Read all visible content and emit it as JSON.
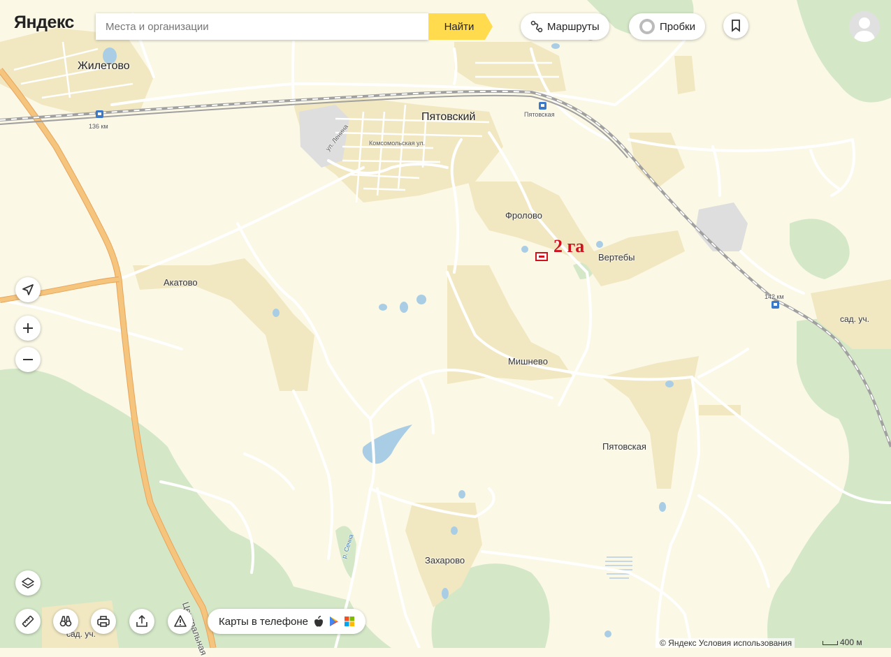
{
  "header": {
    "logo": "Яндекс",
    "search_placeholder": "Места и организации",
    "search_button": "Найти",
    "routes_label": "Маршруты",
    "traffic_label": "Пробки"
  },
  "map": {
    "places": {
      "zhiletovo": "Жилетово",
      "pyatovsky": "Пятовский",
      "frolovo": "Фролово",
      "vertebi": "Вертебы",
      "akatovo": "Акатово",
      "mishnevo": "Мишнево",
      "pyatovskaya_village": "Пятовская",
      "zakharovo": "Захарово",
      "sad_uch_1": "сад. уч.",
      "sad_uch_2": "сад. уч."
    },
    "streets": {
      "lenina": "ул. Ленина",
      "komsomolskaya": "Комсомольская ул.",
      "central": "Центральная",
      "river": "р. Сечна"
    },
    "stations": {
      "km136": "136 км",
      "pyatovskaya_station": "Пятовская",
      "km142": "142 км"
    },
    "annotation": "2 га"
  },
  "controls": {
    "phone_app": "Карты в телефоне"
  },
  "footer": {
    "copyright": "© Яндекс",
    "terms": "Условия использования",
    "scale": "400 м"
  },
  "colors": {
    "land": "#fbf8e6",
    "forest": "#d4e8c8",
    "settlement": "#f1e8c2",
    "water": "#a9cde4",
    "highway": "#f5c47d",
    "railway": "#999999",
    "annotation": "#d0121f"
  }
}
